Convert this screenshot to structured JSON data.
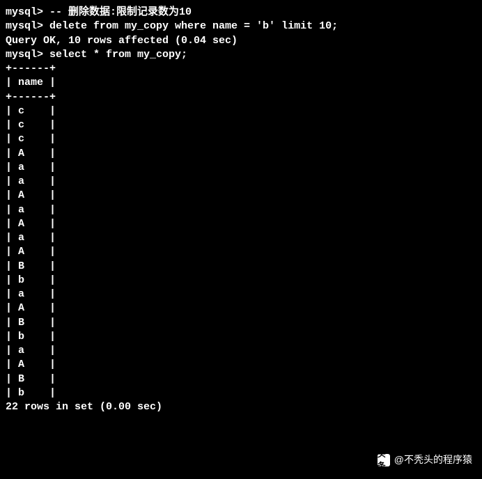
{
  "lines": {
    "l1": "mysql> -- 删除数据:限制记录数为10",
    "l2": "mysql> delete from my_copy where name = 'b' limit 10;",
    "l3": "Query OK, 10 rows affected (0.04 sec)",
    "l4": "",
    "l5": "mysql> select * from my_copy;",
    "l6": "+------+",
    "l7": "| name |",
    "l8": "+------+",
    "l9": "| c    |",
    "l10": "| c    |",
    "l11": "| c    |",
    "l12": "| A    |",
    "l13": "| a    |",
    "l14": "| a    |",
    "l15": "| A    |",
    "l16": "| a    |",
    "l17": "| A    |",
    "l18": "| a    |",
    "l19": "| A    |",
    "l20": "| B    |",
    "l21": "| b    |",
    "l22": "| a    |",
    "l23": "| A    |",
    "l24": "| B    |",
    "l25": "| b    |",
    "l26": "| a    |",
    "l27": "| A    |",
    "l28": "| B    |",
    "l29": "| b    |",
    "l30": "",
    "l31": "22 rows in set (0.00 sec)"
  },
  "watermark": {
    "icon": "头条",
    "text": "@不秃头的程序猿"
  }
}
